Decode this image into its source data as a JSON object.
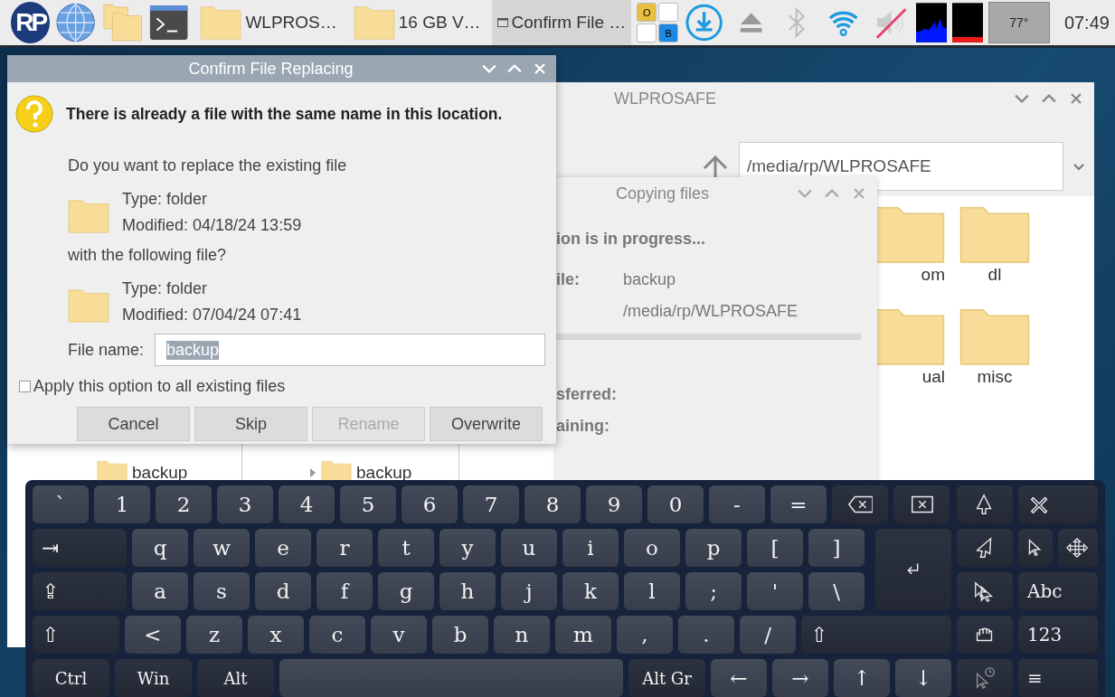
{
  "taskbar": {
    "logo_text": "RP",
    "tasks": [
      {
        "label": "WLPROS…",
        "selected": false
      },
      {
        "label": "16 GB V…",
        "selected": false
      },
      {
        "label": "Confirm File …",
        "selected": true
      }
    ],
    "layout_keys": [
      "O",
      "B"
    ],
    "temperature": "77°",
    "clock": "07:49"
  },
  "tree_window": {
    "panes": [
      {
        "label": "backup",
        "expandable": false
      },
      {
        "label": "backup",
        "expandable": true
      }
    ]
  },
  "file_manager": {
    "title": "WLPROSAFE",
    "path": "/media/rp/WLPROSAFE",
    "items": [
      {
        "label": "om"
      },
      {
        "label": "dl"
      },
      {
        "label": "ual"
      },
      {
        "label": "misc"
      }
    ]
  },
  "copy_dialog": {
    "title": "Copying files",
    "heading": "ion is in progress...",
    "file_label": "ile:",
    "file_values": [
      "backup",
      "/media/rp/WLPROSAFE"
    ],
    "stats": [
      "sferred:",
      "aining:"
    ]
  },
  "confirm_dialog": {
    "title": "Confirm File Replacing",
    "heading": "There is already a file with the same name in this location.",
    "question": "Do you want to replace the existing file",
    "existing": {
      "type": "Type: folder",
      "modified": "Modified: 04/18/24 13:59"
    },
    "with_label": "with the following file?",
    "replacement": {
      "type": "Type: folder",
      "modified": "Modified: 07/04/24 07:41"
    },
    "file_name_label": "File name:",
    "file_name": "backup",
    "apply_all": {
      "label": "Apply this option to all existing files",
      "checked": false
    },
    "buttons": [
      {
        "label": "Cancel",
        "disabled": false
      },
      {
        "label": "Skip",
        "disabled": false
      },
      {
        "label": "Rename",
        "disabled": true
      },
      {
        "label": "Overwrite",
        "disabled": false
      }
    ]
  },
  "keyboard": {
    "main_rows": [
      [
        {
          "kind": "key",
          "label": "`"
        },
        {
          "kind": "key",
          "label": "1"
        },
        {
          "kind": "key",
          "label": "2"
        },
        {
          "kind": "key",
          "label": "3"
        },
        {
          "kind": "key",
          "label": "4"
        },
        {
          "kind": "key",
          "label": "5"
        },
        {
          "kind": "key",
          "label": "6"
        },
        {
          "kind": "key",
          "label": "7"
        },
        {
          "kind": "key",
          "label": "8"
        },
        {
          "kind": "key",
          "label": "9"
        },
        {
          "kind": "key",
          "label": "0"
        },
        {
          "kind": "key",
          "label": "-"
        },
        {
          "kind": "key",
          "label": "="
        },
        {
          "kind": "backspace"
        },
        {
          "kind": "clear"
        }
      ],
      [
        {
          "kind": "tab",
          "label": "⇥"
        },
        {
          "kind": "key",
          "label": "q"
        },
        {
          "kind": "key",
          "label": "w"
        },
        {
          "kind": "key",
          "label": "e"
        },
        {
          "kind": "key",
          "label": "r"
        },
        {
          "kind": "key",
          "label": "t"
        },
        {
          "kind": "key",
          "label": "y"
        },
        {
          "kind": "key",
          "label": "u"
        },
        {
          "kind": "key",
          "label": "i"
        },
        {
          "kind": "key",
          "label": "o"
        },
        {
          "kind": "key",
          "label": "p"
        },
        {
          "kind": "key",
          "label": "["
        },
        {
          "kind": "key",
          "label": "]"
        },
        {
          "kind": "enter"
        }
      ],
      [
        {
          "kind": "caps",
          "label": "⇪"
        },
        {
          "kind": "key",
          "label": "a"
        },
        {
          "kind": "key",
          "label": "s"
        },
        {
          "kind": "key",
          "label": "d"
        },
        {
          "kind": "key",
          "label": "f"
        },
        {
          "kind": "key",
          "label": "g"
        },
        {
          "kind": "key",
          "label": "h"
        },
        {
          "kind": "key",
          "label": "j"
        },
        {
          "kind": "key",
          "label": "k"
        },
        {
          "kind": "key",
          "label": "l"
        },
        {
          "kind": "key",
          "label": ";"
        },
        {
          "kind": "key",
          "label": "'"
        },
        {
          "kind": "key",
          "label": "\\"
        }
      ],
      [
        {
          "kind": "shift",
          "label": "⇧"
        },
        {
          "kind": "key",
          "label": "<"
        },
        {
          "kind": "key",
          "label": "z"
        },
        {
          "kind": "key",
          "label": "x"
        },
        {
          "kind": "key",
          "label": "c"
        },
        {
          "kind": "key",
          "label": "v"
        },
        {
          "kind": "key",
          "label": "b"
        },
        {
          "kind": "key",
          "label": "n"
        },
        {
          "kind": "key",
          "label": "m"
        },
        {
          "kind": "key",
          "label": ","
        },
        {
          "kind": "key",
          "label": "."
        },
        {
          "kind": "key",
          "label": "/"
        },
        {
          "kind": "shift-right",
          "label": "⇧"
        }
      ],
      [
        {
          "kind": "mod",
          "label": "Ctrl"
        },
        {
          "kind": "mod",
          "label": "Win"
        },
        {
          "kind": "mod",
          "label": "Alt"
        },
        {
          "kind": "space"
        },
        {
          "kind": "mod",
          "label": "Alt Gr"
        },
        {
          "kind": "key",
          "label": "←"
        },
        {
          "kind": "key",
          "label": "→"
        },
        {
          "kind": "key",
          "label": "↑"
        },
        {
          "kind": "key",
          "label": "↓"
        }
      ]
    ],
    "side_rows": [
      [
        {
          "kind": "pointer"
        },
        {
          "kind": "close"
        }
      ],
      [
        {
          "kind": "pointer-tilted"
        },
        {
          "kind": "pointer-small"
        },
        {
          "kind": "move"
        }
      ],
      [
        {
          "kind": "pointer-double"
        },
        {
          "kind": "text",
          "label": "Abc"
        }
      ],
      [
        {
          "kind": "hand"
        },
        {
          "kind": "text",
          "label": "123"
        }
      ],
      [
        {
          "kind": "pointer-timer"
        },
        {
          "kind": "text",
          "label": "≡"
        }
      ]
    ]
  }
}
